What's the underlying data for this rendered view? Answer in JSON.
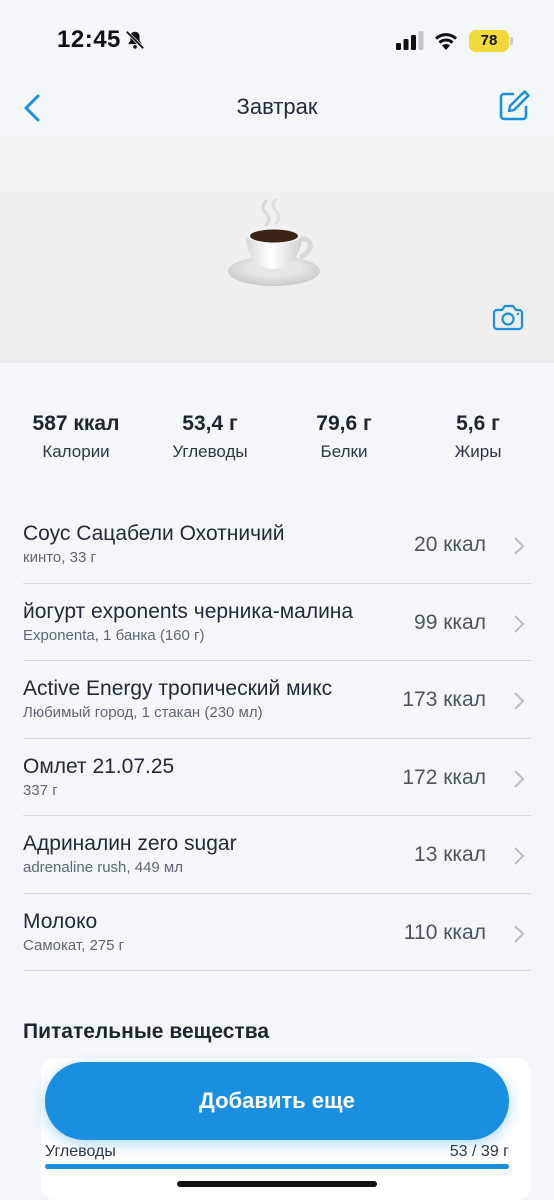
{
  "status_bar": {
    "time": "12:45",
    "battery": "78"
  },
  "nav": {
    "title": "Завтрак"
  },
  "summary": [
    {
      "value": "587 ккал",
      "label": "Калории"
    },
    {
      "value": "53,4 г",
      "label": "Углеводы"
    },
    {
      "value": "79,6 г",
      "label": "Белки"
    },
    {
      "value": "5,6 г",
      "label": "Жиры"
    }
  ],
  "foods": [
    {
      "name": "Соус Сацабели Охотничий",
      "detail": "кинто, 33 г",
      "kcal": "20 ккал"
    },
    {
      "name": "йогурт exponents черника-малина",
      "detail": "Exponenta, 1 банка (160 г)",
      "kcal": "99 ккал"
    },
    {
      "name": "Active Energy тропический микс",
      "detail": "Любимый город, 1 стакан (230 мл)",
      "kcal": "173 ккал"
    },
    {
      "name": "Омлет 21.07.25",
      "detail": "337 г",
      "kcal": "172 ккал"
    },
    {
      "name": "Адриналин zero sugar",
      "detail": "adrenaline rush, 449 мл",
      "kcal": "13 ккал"
    },
    {
      "name": "Молоко",
      "detail": "Самокат, 275 г",
      "kcal": "110 ккал"
    }
  ],
  "nutrients": {
    "title": "Питательные вещества",
    "rows": [
      {
        "label": "Углеводы",
        "value": "53 / 39 г",
        "progress": 1.0
      }
    ]
  },
  "add_button": {
    "label": "Добавить еще"
  },
  "colors": {
    "accent": "#1a8fe0",
    "battery": "#f1d93a"
  }
}
